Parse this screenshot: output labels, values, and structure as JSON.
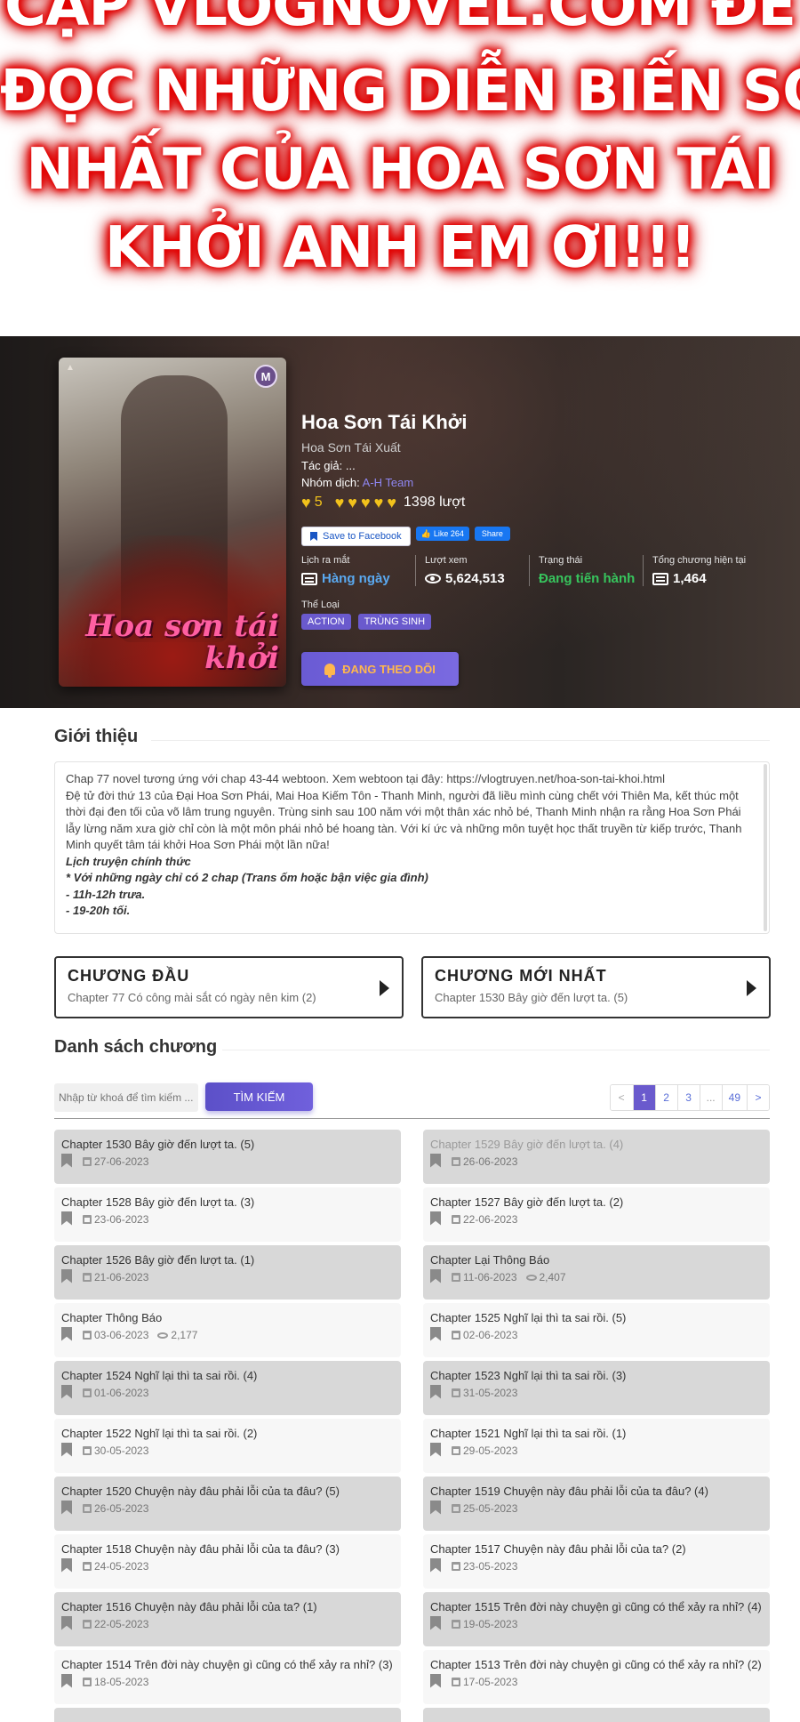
{
  "promo": {
    "line1": "CẬP VLOGNOVEL.COM ĐỂ",
    "line2": "ĐỌC NHỮNG DIỄN BIẾN SỚM",
    "line3": "NHẤT CỦA HOA SƠN TÁI",
    "line4": "KHỞI ANH EM ƠI!!!",
    "glow_color": "#e30000"
  },
  "manga": {
    "cover_title": "Hoa sơn tái khởi",
    "title": "Hoa Sơn Tái Khởi",
    "alt_title": "Hoa Sơn Tái Xuất",
    "author_label": "Tác giả:",
    "author_value": "...",
    "team_label": "Nhóm dịch:",
    "team_value": "A-H Team",
    "rating_score": "5",
    "rating_hearts": 5,
    "rating_count": "1398 lượt",
    "save_facebook": "Save to Facebook",
    "like_label": "Like 264",
    "share_label": "Share",
    "stats": {
      "release_label": "Lịch ra mắt",
      "release_value": "Hàng ngày",
      "views_label": "Lượt xem",
      "views_value": "5,624,513",
      "status_label": "Trạng thái",
      "status_value": "Đang tiến hành",
      "total_label": "Tổng chương hiện tại",
      "total_value": "1,464"
    },
    "genre_label": "Thể Loại",
    "genres": [
      "ACTION",
      "TRÙNG SINH"
    ],
    "follow_label": "ĐANG THEO DÕI"
  },
  "intro": {
    "heading": "Giới thiệu",
    "p1": "Chap 77 novel tương ứng với chap 43-44 webtoon. Xem webtoon tại đây: https://vlogtruyen.net/hoa-son-tai-khoi.html",
    "p2": "Đệ tử đời thứ 13 của Đại Hoa Sơn Phái, Mai Hoa Kiếm Tôn - Thanh Minh, người đã liều mình cùng chết với Thiên Ma, kết thúc một thời đại đen tối của võ lâm trung nguyên. Trùng sinh sau 100 năm với một thân xác nhỏ bé, Thanh Minh nhận ra rằng Hoa Sơn Phái lẫy lừng năm xưa giờ chỉ còn là một môn phái nhỏ bé hoang tàn. Với kí ức và những môn tuyệt học thất truyền từ kiếp trước, Thanh Minh quyết tâm tái khởi Hoa Sơn Phái một lần nữa!",
    "schedule_title": "Lịch truyện chính thức",
    "schedule_note": "* Với những ngày chỉ có 2 chap (Trans ốm hoặc bận việc gia đình)",
    "schedule_1": "- 11h-12h trưa.",
    "schedule_2": "- 19-20h tối."
  },
  "first_chapter": {
    "heading": "CHƯƠNG ĐẦU",
    "name": "Chapter 77 Có công mài sắt có ngày nên kim (2)"
  },
  "latest_chapter": {
    "heading": "CHƯƠNG MỚI NHẤT",
    "name": "Chapter 1530 Bây giờ đến lượt ta. (5)"
  },
  "chapter_list": {
    "heading": "Danh sách chương",
    "search_placeholder": "Nhập từ khoá để tìm kiếm ...",
    "search_button": "TÌM KIẾM",
    "pages": [
      "<",
      "1",
      "2",
      "3",
      "...",
      "49",
      ">"
    ],
    "active_page": "1",
    "items": [
      {
        "name": "Chapter 1530 Bây giờ đến lượt ta. (5)",
        "date": "27-06-2023",
        "views": ""
      },
      {
        "name": "Chapter 1529 Bây giờ đến lượt ta. (4)",
        "date": "26-06-2023",
        "views": ""
      },
      {
        "name": "Chapter 1528 Bây giờ đến lượt ta. (3)",
        "date": "23-06-2023",
        "views": ""
      },
      {
        "name": "Chapter 1527 Bây giờ đến lượt ta. (2)",
        "date": "22-06-2023",
        "views": ""
      },
      {
        "name": "Chapter 1526 Bây giờ đến lượt ta. (1)",
        "date": "21-06-2023",
        "views": ""
      },
      {
        "name": "Chapter Lại Thông Báo",
        "date": "11-06-2023",
        "views": "2,407"
      },
      {
        "name": "Chapter Thông Báo",
        "date": "03-06-2023",
        "views": "2,177"
      },
      {
        "name": "Chapter 1525 Nghĩ lại thì ta sai rồi. (5)",
        "date": "02-06-2023",
        "views": ""
      },
      {
        "name": "Chapter 1524 Nghĩ lại thì ta sai rồi. (4)",
        "date": "01-06-2023",
        "views": ""
      },
      {
        "name": "Chapter 1523 Nghĩ lại thì ta sai rồi. (3)",
        "date": "31-05-2023",
        "views": ""
      },
      {
        "name": "Chapter 1522 Nghĩ lại thì ta sai rồi. (2)",
        "date": "30-05-2023",
        "views": ""
      },
      {
        "name": "Chapter 1521 Nghĩ lại thì ta sai rồi. (1)",
        "date": "29-05-2023",
        "views": ""
      },
      {
        "name": "Chapter 1520 Chuyện này đâu phải lỗi của ta đâu? (5)",
        "date": "26-05-2023",
        "views": ""
      },
      {
        "name": "Chapter 1519 Chuyện này đâu phải lỗi của ta đâu? (4)",
        "date": "25-05-2023",
        "views": ""
      },
      {
        "name": "Chapter 1518 Chuyện này đâu phải lỗi của ta đâu? (3)",
        "date": "24-05-2023",
        "views": ""
      },
      {
        "name": "Chapter 1517 Chuyện này đâu phải lỗi của ta? (2)",
        "date": "23-05-2023",
        "views": ""
      },
      {
        "name": "Chapter 1516 Chuyện này đâu phải lỗi của ta? (1)",
        "date": "22-05-2023",
        "views": ""
      },
      {
        "name": "Chapter 1515 Trên đời này chuyện gì cũng có thể xảy ra nhỉ? (4)",
        "date": "19-05-2023",
        "views": ""
      },
      {
        "name": "Chapter 1514 Trên đời này chuyện gì cũng có thể xảy ra nhỉ? (3)",
        "date": "18-05-2023",
        "views": ""
      },
      {
        "name": "Chapter 1513 Trên đời này chuyện gì cũng có thể xảy ra nhỉ? (2)",
        "date": "17-05-2023",
        "views": ""
      },
      {
        "name": "",
        "date": "",
        "views": ""
      },
      {
        "name": "",
        "date": "",
        "views": ""
      }
    ]
  }
}
